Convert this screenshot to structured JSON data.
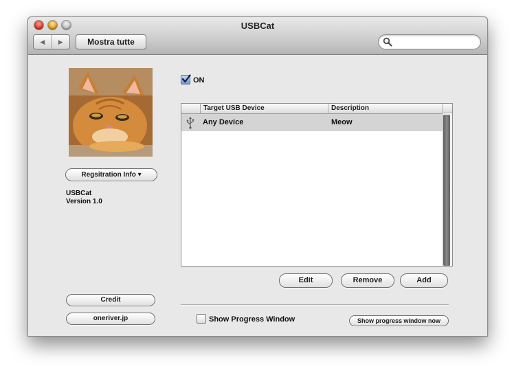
{
  "window": {
    "title": "USBCat"
  },
  "toolbar": {
    "back_label": "◀",
    "forward_label": "▶",
    "show_all_label": "Mostra tutte",
    "search_placeholder": ""
  },
  "sidebar": {
    "registration_label": "Regsitration Info ▾",
    "app_name": "USBCat",
    "app_version": "Version 1.0",
    "credit_label": "Credit",
    "site_label": "oneriver.jp"
  },
  "main": {
    "on_label": "ON",
    "on_checked": true,
    "table": {
      "columns": [
        "",
        "Target USB Device",
        "Description"
      ],
      "rows": [
        {
          "icon": "usb-icon",
          "device": "Any Device",
          "description": "Meow"
        }
      ]
    },
    "edit_label": "Edit",
    "remove_label": "Remove",
    "add_label": "Add",
    "progress_label": "Show Progress Window",
    "progress_checked": false,
    "progress_now_label": "Show progress window now"
  }
}
